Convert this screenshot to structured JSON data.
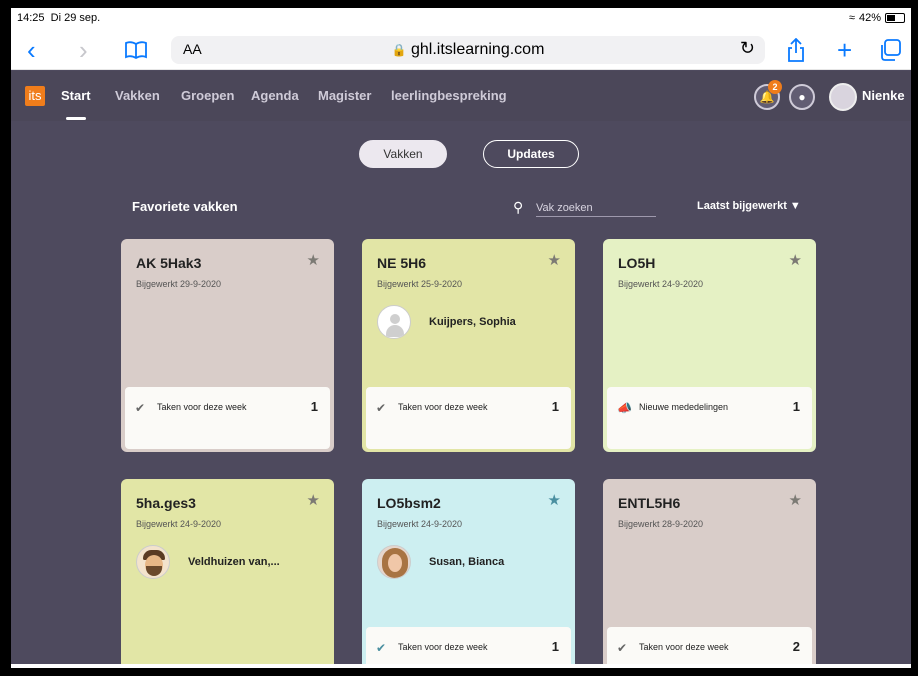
{
  "status_bar": {
    "time": "14:25",
    "date": "Di 29 sep.",
    "wifi_icon": "wifi-icon",
    "battery": "42%"
  },
  "browser": {
    "text_size": "AA",
    "url": "ghl.itslearning.com"
  },
  "app": {
    "logo": "its",
    "nav": [
      "Start",
      "Vakken",
      "Groepen",
      "Agenda",
      "Magister",
      "leerlingbespreking"
    ],
    "active_nav": "Start",
    "notifications": "2",
    "user_name": "Nienke",
    "accent_color": "#f07d1b"
  },
  "toggle": {
    "vakken": "Vakken",
    "updates": "Updates"
  },
  "section": {
    "title": "Favoriete vakken",
    "search_placeholder": "Vak zoeken",
    "sort": "Laatst bijgewerkt"
  },
  "cards": [
    {
      "title": "AK 5Hak3",
      "updated": "Bijgewerkt 29-9-2020",
      "color": "#d9cdc9",
      "footer_label": "Taken voor deze week",
      "footer_icon": "check-icon",
      "footer_count": "1"
    },
    {
      "title": "NE 5H6",
      "updated": "Bijgewerkt 25-9-2020",
      "color": "#e2e5a6",
      "person": "Kuijpers, Sophia",
      "footer_label": "Taken voor deze week",
      "footer_icon": "check-icon",
      "footer_count": "1"
    },
    {
      "title": "LO5H",
      "updated": "Bijgewerkt 24-9-2020",
      "color": "#e5f1c4",
      "footer_label": "Nieuwe mededelingen",
      "footer_icon": "megaphone-icon",
      "footer_count": "1"
    },
    {
      "title": "5ha.ges3",
      "updated": "Bijgewerkt 24-9-2020",
      "color": "#e2e6a6",
      "person": "Veldhuizen van,..."
    },
    {
      "title": "LO5bsm2",
      "updated": "Bijgewerkt 24-9-2020",
      "color": "#cdeff1",
      "person": "Susan, Bianca",
      "footer_label": "Taken voor deze week",
      "footer_icon": "check-icon",
      "footer_count": "1"
    },
    {
      "title": "ENTL5H6",
      "updated": "Bijgewerkt 28-9-2020",
      "color": "#d9cdc9",
      "footer_label": "Taken voor deze week",
      "footer_icon": "check-icon",
      "footer_count": "2"
    }
  ]
}
